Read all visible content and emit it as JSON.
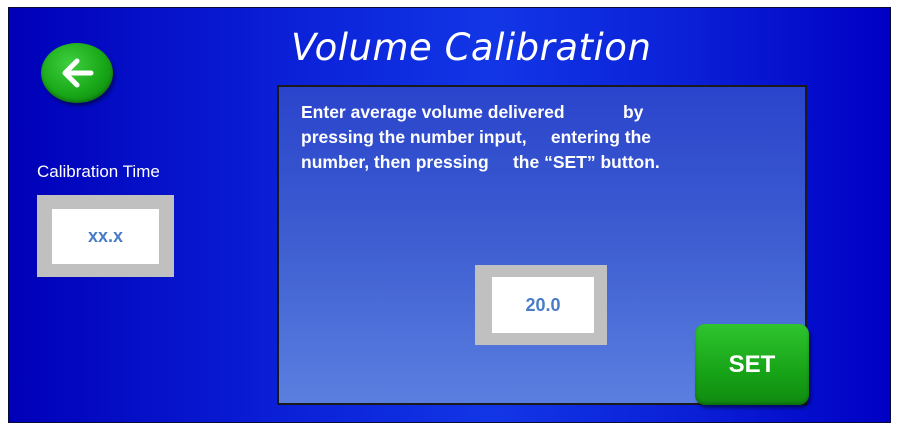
{
  "header": {
    "title": "Volume Calibration",
    "back_icon": "arrow-left-icon"
  },
  "calibration_time": {
    "label": "Calibration Time",
    "value": "xx.x"
  },
  "panel": {
    "instructions": [
      "Enter average volume delivered            by",
      "pressing the number input,     entering the",
      "number, then pressing     the “SET” button."
    ],
    "volume_value": "20.0",
    "set_label": "SET"
  },
  "colors": {
    "background": "#0a1fd6",
    "button_green": "#17a317",
    "field_frame": "#c0c0c0",
    "field_text": "#4a7cc8"
  }
}
